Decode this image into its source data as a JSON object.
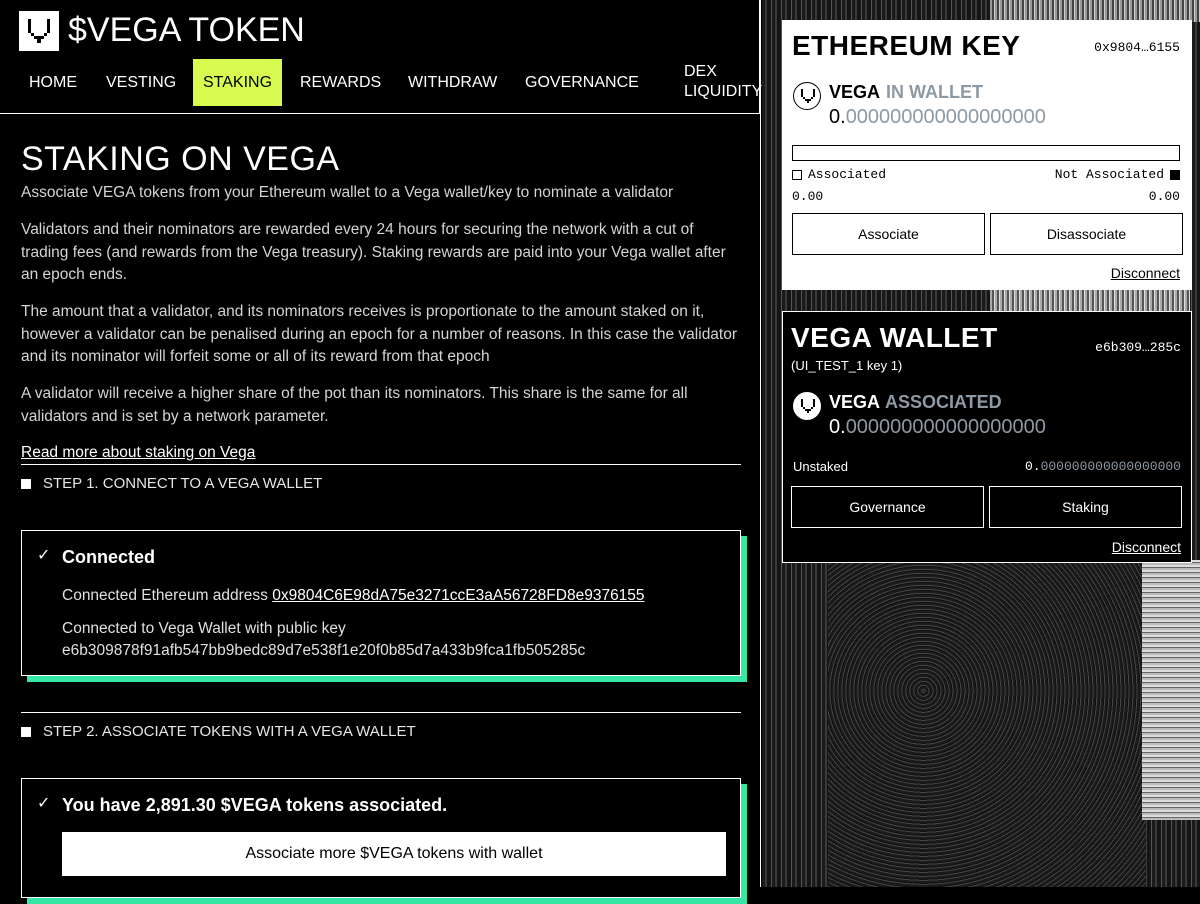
{
  "app": {
    "title": "$VEGA TOKEN"
  },
  "nav": {
    "items": [
      {
        "label": "HOME"
      },
      {
        "label": "VESTING"
      },
      {
        "label": "STAKING"
      },
      {
        "label": "REWARDS"
      },
      {
        "label": "WITHDRAW"
      },
      {
        "label": "GOVERNANCE"
      }
    ],
    "dex_line1": "DEX",
    "dex_line2": "LIQUIDITY",
    "active": "STAKING"
  },
  "main": {
    "title": "STAKING ON VEGA",
    "paragraphs": [
      "Associate VEGA tokens from your Ethereum wallet to a Vega wallet/key to nominate a validator",
      "Validators and their nominators are rewarded every 24 hours for securing the network with a cut of trading fees (and rewards from the Vega treasury). Staking rewards are paid into your Vega wallet after an epoch ends.",
      "The amount that a validator, and its nominators receives is proportionate to the amount staked on it, however a validator can be penalised during an epoch for a number of reasons. In this case the validator and its nominator will forfeit some or all of its reward from that epoch",
      "A validator will receive a higher share of the pot than its nominators. This share is the same for all validators and is set by a network parameter."
    ],
    "read_more": "Read more about staking on Vega",
    "step1": {
      "label": "STEP 1. CONNECT TO A VEGA WALLET",
      "card_title": "Connected",
      "eth_prefix": "Connected Ethereum address ",
      "eth_address": "0x9804C6E98dA75e3271ccE3aA56728FD8e9376155",
      "vega_prefix": "Connected to Vega Wallet with public key",
      "vega_key": "e6b309878f91afb547bb9bedc89d7e538f1e20f0b85d7a433b9fca1fb505285c"
    },
    "step2": {
      "label": "STEP 2. ASSOCIATE TOKENS WITH A VEGA WALLET",
      "card_title": "You have 2,891.30 $VEGA tokens associated.",
      "button": "Associate more $VEGA tokens with wallet"
    }
  },
  "eth_panel": {
    "title": "ETHEREUM KEY",
    "key": "0x9804…6155",
    "token": "VEGA",
    "status": "IN WALLET",
    "balance_int": "0.",
    "balance_dec": "000000000000000000",
    "associated_label": "Associated",
    "not_associated_label": "Not Associated",
    "associated_value": "0.00",
    "not_associated_value": "0.00",
    "associate_button": "Associate",
    "disassociate_button": "Disassociate",
    "disconnect": "Disconnect"
  },
  "vega_panel": {
    "title": "VEGA WALLET",
    "subtitle": "(UI_TEST_1 key 1)",
    "key": "e6b309…285c",
    "token": "VEGA",
    "status": "ASSOCIATED",
    "balance_int": "0.",
    "balance_dec": "000000000000000000",
    "unstaked_label": "Unstaked",
    "unstaked_int": "0.",
    "unstaked_dec": "000000000000000000",
    "governance_button": "Governance",
    "staking_button": "Staking",
    "disconnect": "Disconnect"
  },
  "colors": {
    "accent": "#d7fb50",
    "card_shadow": "#35e6a4",
    "muted": "#8e99a3"
  },
  "icons": [
    "vega-logo-icon",
    "check-icon",
    "step-square-icon",
    "vega-token-icon"
  ]
}
